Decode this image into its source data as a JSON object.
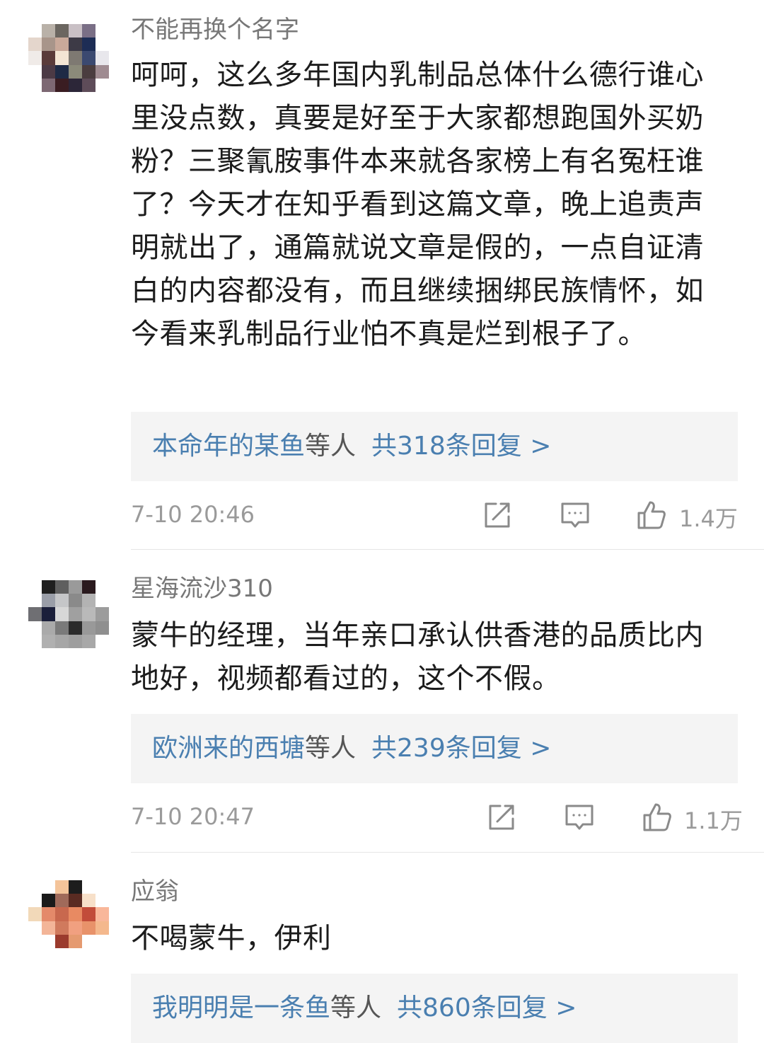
{
  "comments": [
    {
      "username": "不能再换个名字",
      "body": "呵呵，这么多年国内乳制品总体什么德行谁心里没点数，真要是好至于大家都想跑国外买奶粉？三聚氰胺事件本来就各家榜上有名冤枉谁了？今天才在知乎看到这篇文章，晚上追责声明就出了，通篇就说文章是假的，一点自证清白的内容都没有，而且继续捆绑民族情怀，如今看来乳制品行业怕不真是烂到根子了。",
      "reply_user": "本命年的某鱼",
      "reply_etc": "等人",
      "reply_count": "共318条回复 >",
      "timestamp": "7-10 20:46",
      "likes": "1.4万"
    },
    {
      "username": "星海流沙310",
      "body": "蒙牛的经理，当年亲口承认供香港的品质比内地好，视频都看过的，这个不假。",
      "reply_user": "欧洲来的西塘",
      "reply_etc": "等人",
      "reply_count": "共239条回复 >",
      "timestamp": "7-10 20:47",
      "likes": "1.1万"
    },
    {
      "username": "应翁",
      "body": "不喝蒙牛，伊利",
      "reply_user": "我明明是一条鱼",
      "reply_etc": "等人",
      "reply_count": "共860条回复 >"
    }
  ],
  "icons": {
    "share": "share-icon",
    "comment": "comment-icon",
    "like": "thumbs-up-icon"
  },
  "colors": {
    "link": "#4a7fb0",
    "muted": "#9a9a9a",
    "reply_bg": "#f4f4f4"
  }
}
